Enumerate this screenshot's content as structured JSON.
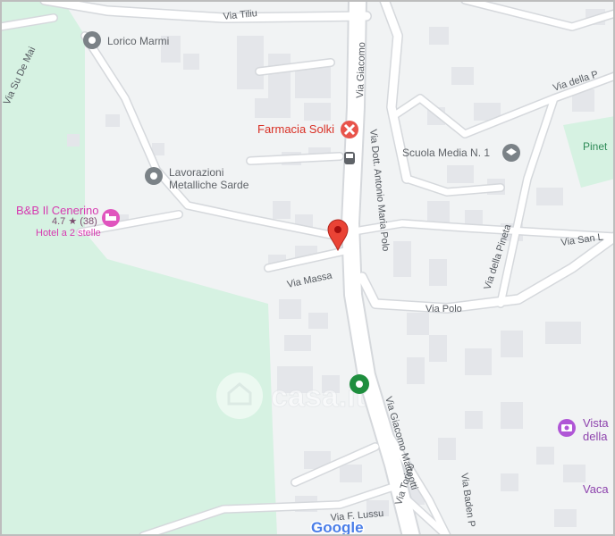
{
  "colors": {
    "land": "#f1f3f4",
    "park": "#d6f2e2",
    "road": "#ffffff",
    "road_edge": "#d5d8dc",
    "building": "#e6e8eb",
    "marker_red": "#ea4335",
    "marker_green": "#1e8e3e",
    "poi_grey": "#5f6368",
    "pharmacy_red": "#d93025",
    "hotel_pink": "#d63ab0"
  },
  "roads": {
    "via_tiliu": "Via Tiliu",
    "via_giacomo_top": "Via Giacomo",
    "via_della_p": "Via della P",
    "via_su_de_mai": "Via Su De Mai",
    "via_antonio_maria_polo": "Via Dott. Antonio Maria Polo",
    "via_della_pineta": "Via della Pineta",
    "via_san_l": "Via San L",
    "via_massa": "Via Massa",
    "via_polo": "Via Polo",
    "via_giacomo_matteotti": "Via Giacomo Matteotti",
    "via_torino": "Via Torino",
    "via_baden_p": "Via Baden P",
    "via_f_lussu": "Via F. Lussu"
  },
  "pois": {
    "lorico": "Lorico Marmi",
    "lavorazioni_1": "Lavorazioni",
    "lavorazioni_2": "Metalliche Sarde",
    "farmacia": "Farmacia Solki",
    "scuola": "Scuola Media N. 1",
    "pinet": "Pinet",
    "hotel_name": "B&B Il Cenerino",
    "hotel_rating": "4.7 ★ (38)",
    "hotel_type": "Hotel a 2 stelle",
    "vista_1": "Vista",
    "vista_2": "della",
    "vaca": "Vaca"
  },
  "icons": {
    "lorico": "map-pin-icon",
    "lavorazioni": "map-pin-icon",
    "farmacia": "pharmacy-icon",
    "bus": "bus-stop-icon",
    "scuola": "school-icon",
    "hotel": "hotel-bed-icon",
    "vista": "camera-icon",
    "selected": "location-marker-icon",
    "green": "green-location-icon"
  },
  "watermark": "casa.it",
  "google_logo": "Google"
}
